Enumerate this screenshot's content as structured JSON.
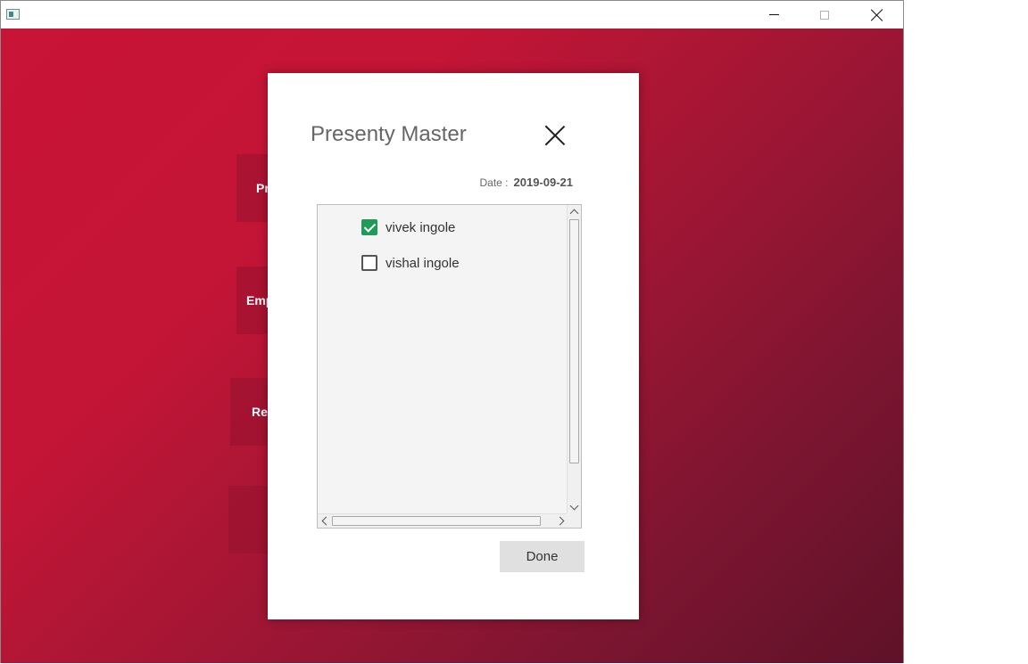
{
  "window": {
    "title": "",
    "controls": {
      "minimize": "minimize",
      "maximize": "maximize",
      "close": "close"
    }
  },
  "background": {
    "tiles": [
      "Pr",
      "Emp",
      "Re",
      ""
    ],
    "gradient_colors": [
      "#c81436",
      "#5e1228"
    ]
  },
  "dialog": {
    "title": "Presenty Master",
    "date_label": "Date :",
    "date_value": "2019-09-21",
    "employees": [
      {
        "name": "vivek ingole",
        "checked": true
      },
      {
        "name": "vishal ingole",
        "checked": false
      }
    ],
    "done_label": "Done",
    "check_color": "#1e9b58"
  }
}
